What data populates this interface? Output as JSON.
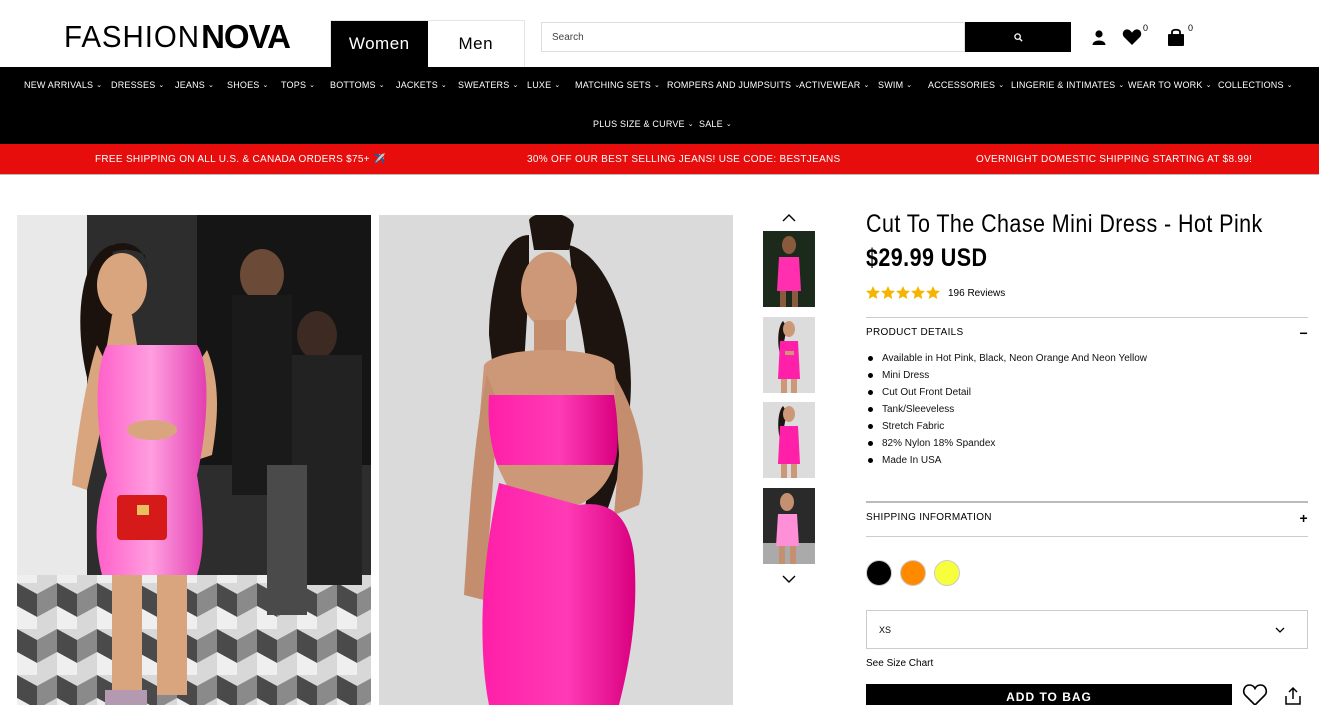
{
  "header": {
    "logo_left": "FASHION",
    "logo_right": "NOVA",
    "tabs": [
      {
        "label": "Women",
        "active": true
      },
      {
        "label": "Men",
        "active": false
      }
    ],
    "search_placeholder": "Search",
    "wishlist_count": "0",
    "cart_count": "0",
    "icons": [
      "search-icon",
      "user-icon",
      "heart-icon",
      "shopping-bag-icon"
    ]
  },
  "nav": {
    "row1": [
      "NEW ARRIVALS",
      "DRESSES",
      "JEANS",
      "SHOES",
      "TOPS",
      "BOTTOMS",
      "JACKETS",
      "SWEATERS",
      "LUXE",
      "MATCHING SETS",
      "ROMPERS AND JUMPSUITS",
      "ACTIVEWEAR",
      "SWIM",
      "ACCESSORIES",
      "LINGERIE & INTIMATES",
      "WEAR TO WORK",
      "COLLECTIONS"
    ],
    "row2": [
      "PLUS SIZE & CURVE",
      "SALE"
    ]
  },
  "promo": {
    "items": [
      "FREE SHIPPING ON ALL U.S. & CANADA ORDERS $75+ ✈️",
      "30% OFF OUR BEST SELLING JEANS! USE CODE: BESTJEANS",
      "OVERNIGHT DOMESTIC SHIPPING STARTING AT $8.99!"
    ]
  },
  "product": {
    "title": "Cut To The Chase Mini Dress - Hot Pink",
    "price": "$29.99 USD",
    "rating": 5,
    "reviews": "196 Reviews",
    "details_heading": "PRODUCT DETAILS",
    "details_toggle": "−",
    "details": [
      "Available in Hot Pink, Black, Neon Orange And Neon Yellow",
      "Mini Dress",
      "Cut Out Front Detail",
      "Tank/Sleeveless",
      "Stretch Fabric",
      "82% Nylon 18% Spandex",
      "Made In USA"
    ],
    "shipping_heading": "SHIPPING INFORMATION",
    "shipping_toggle": "+",
    "colors": [
      {
        "name": "Black",
        "hex": "#000000"
      },
      {
        "name": "Neon Orange",
        "hex": "#ff8a00"
      },
      {
        "name": "Neon Yellow",
        "hex": "#f7ff3c"
      }
    ],
    "size_selected": "XS",
    "size_chart_label": "See Size Chart",
    "add_to_bag_label": "ADD TO BAG"
  },
  "colors": {
    "brand_black": "#000000",
    "promo_red": "#e80d0d",
    "star_gold": "#f6b400",
    "dress_pink": "#ff1aa8"
  }
}
